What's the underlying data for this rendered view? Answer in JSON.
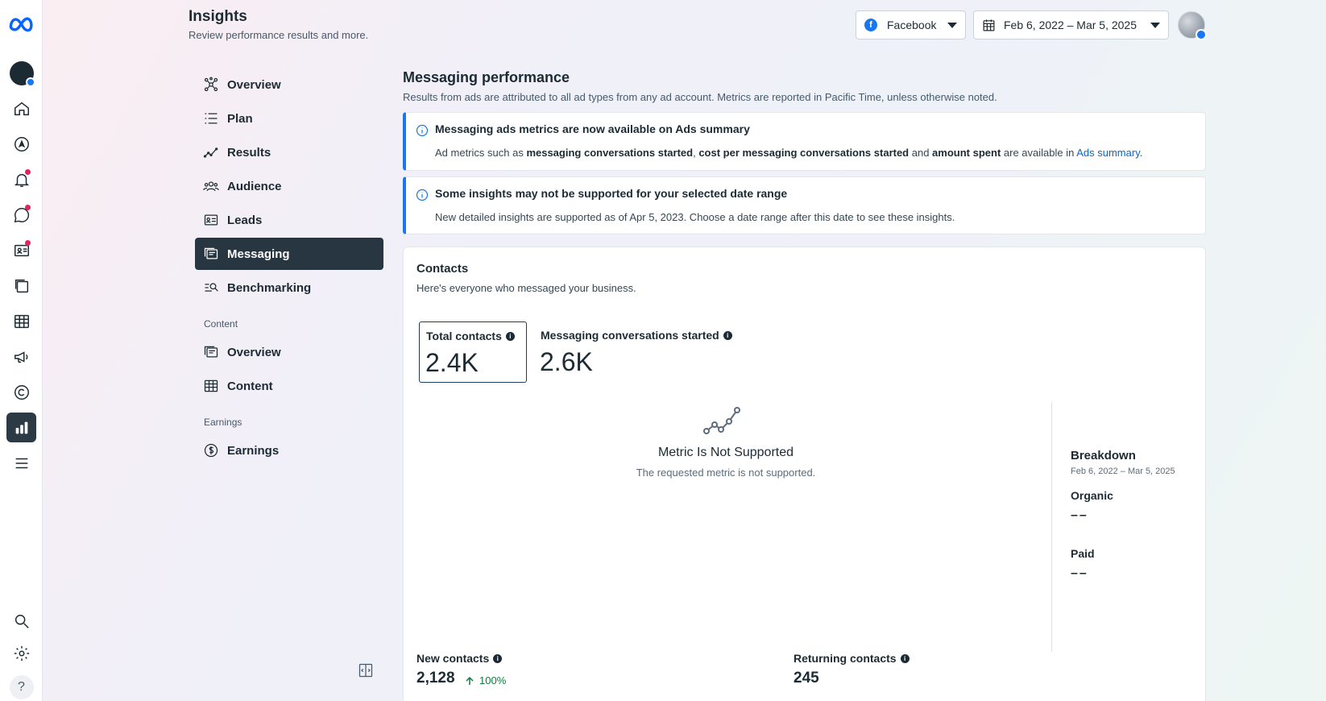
{
  "header": {
    "title": "Insights",
    "subtitle": "Review performance results and more.",
    "platform": "Facebook",
    "date_range": "Feb 6, 2022 – Mar 5, 2025"
  },
  "rail": {
    "icons": [
      "meta-logo-icon",
      "account-avatar-icon",
      "home-icon",
      "compass-icon",
      "bell-icon",
      "chat-icon",
      "contact-card-icon",
      "pages-icon",
      "table-icon",
      "megaphone-icon",
      "copyright-icon",
      "bar-chart-icon",
      "menu-icon",
      "search-icon",
      "gear-icon",
      "help-icon"
    ],
    "help_label": "?"
  },
  "subnav": {
    "items": [
      {
        "label": "Overview",
        "icon": "overview-icon"
      },
      {
        "label": "Plan",
        "icon": "plan-icon"
      },
      {
        "label": "Results",
        "icon": "results-icon"
      },
      {
        "label": "Audience",
        "icon": "audience-icon"
      },
      {
        "label": "Leads",
        "icon": "leads-icon"
      },
      {
        "label": "Messaging",
        "icon": "messaging-icon"
      },
      {
        "label": "Benchmarking",
        "icon": "benchmarking-icon"
      }
    ],
    "content_section": "Content",
    "content_items": [
      {
        "label": "Overview",
        "icon": "content-overview-icon"
      },
      {
        "label": "Content",
        "icon": "content-table-icon"
      }
    ],
    "earnings_section": "Earnings",
    "earnings_items": [
      {
        "label": "Earnings",
        "icon": "dollar-icon"
      }
    ]
  },
  "main": {
    "title": "Messaging performance",
    "subtitle": "Results from ads are attributed to all ad types from any ad account. Metrics are reported in Pacific Time, unless otherwise noted.",
    "notices": [
      {
        "title": "Messaging ads metrics are now available on Ads summary",
        "body_pre": "Ad metrics such as ",
        "body_b1": "messaging conversations started",
        "body_mid1": ", ",
        "body_b2": "cost per messaging conversations started",
        "body_mid2": " and ",
        "body_b3": "amount spent",
        "body_post": " are available in ",
        "link": "Ads summary",
        "body_end": "."
      },
      {
        "title": "Some insights may not be supported for your selected date range",
        "body": "New detailed insights are supported as of Apr 5, 2023. Choose a date range after this date to see these insights."
      }
    ],
    "contacts": {
      "title": "Contacts",
      "subtitle": "Here's everyone who messaged your business.",
      "tabs": [
        {
          "label": "Total contacts",
          "value": "2.4K"
        },
        {
          "label": "Messaging conversations started",
          "value": "2.6K"
        }
      ],
      "empty_title": "Metric Is Not Supported",
      "empty_sub": "The requested metric is not supported.",
      "breakdown": {
        "title": "Breakdown",
        "date": "Feb 6, 2022 – Mar 5, 2025",
        "organic_label": "Organic",
        "organic_value": "––",
        "paid_label": "Paid",
        "paid_value": "––"
      },
      "new_contacts": {
        "label": "New contacts",
        "value": "2,128",
        "trend": "100%"
      },
      "returning_contacts": {
        "label": "Returning contacts",
        "value": "245"
      }
    }
  },
  "colors": {
    "accent": "#1877f2",
    "active_nav": "#283642",
    "trend_green": "#117a3c",
    "notification_dot": "#e0245e"
  }
}
